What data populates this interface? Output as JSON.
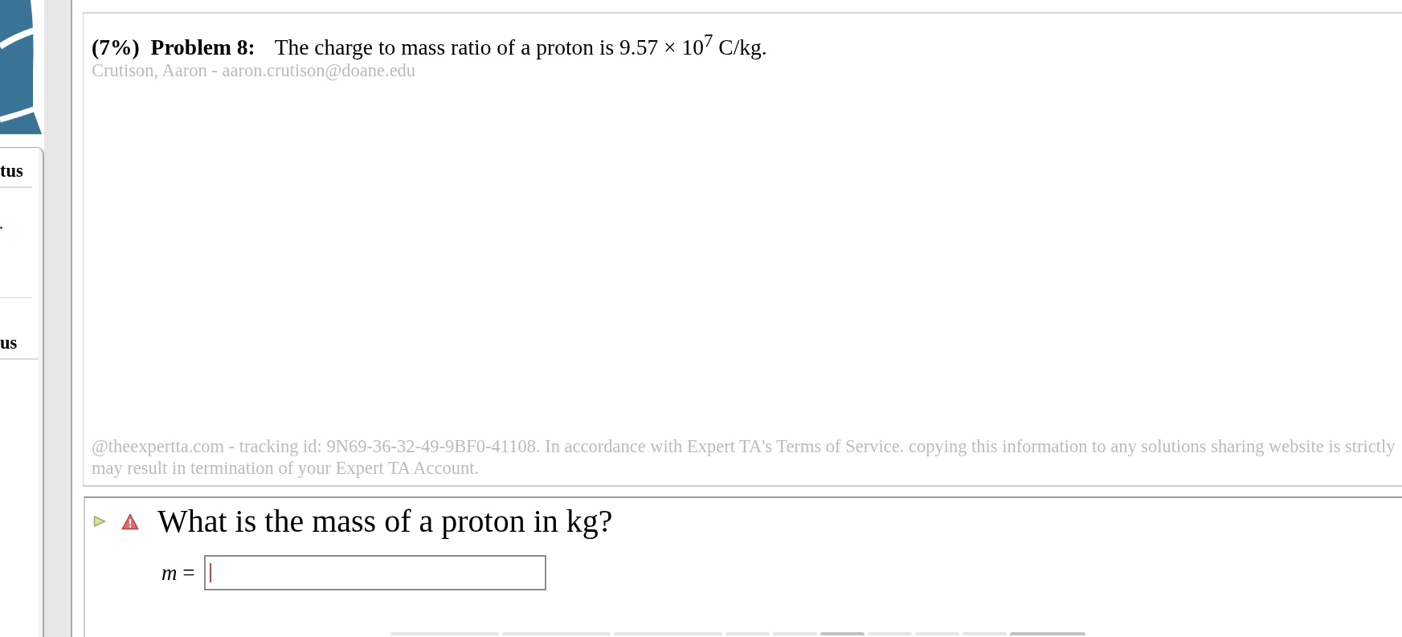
{
  "sidebar": {
    "sections": [
      {
        "heading": "tus"
      },
      {
        "heading": "us"
      }
    ]
  },
  "problem": {
    "weight": "(7%)",
    "title": "Problem 8:",
    "statement": "The charge to mass ratio of a proton is 9.57 × 10$^{7}$ C/kg.",
    "author": "Crutison, Aaron - aaron.crutison@doane.edu",
    "notice_lines": [
      "@theexpertta.com - tracking id: 9N69-36-32-49-9BF0-41108. In accordance with Expert TA's Terms of Service. copying this information to any solutions sharing website is strictly",
      "may result in termination of your Expert TA Account."
    ]
  },
  "question": {
    "text": "What is the mass of a proton in kg?",
    "answer": {
      "label": "*m* =",
      "focused": true
    }
  },
  "keypad": [
    {
      "kind": "wide",
      "color": "#e6e6e6"
    },
    {
      "kind": "wide",
      "color": "#e6e6e6"
    },
    {
      "kind": "wide",
      "color": "#e6e6e6"
    },
    {
      "kind": "narrow",
      "color": "#e6e6e6"
    },
    {
      "kind": "narrow",
      "color": "#e6e6e6"
    },
    {
      "kind": "narrow",
      "color": "#c2c2c2"
    },
    {
      "kind": "narrow",
      "color": "#e6e6e6"
    },
    {
      "kind": "narrow",
      "color": "#e6e6e6"
    },
    {
      "kind": "narrow",
      "color": "#e6e6e6"
    },
    {
      "kind": "long",
      "color": "#c2c2c2"
    }
  ]
}
